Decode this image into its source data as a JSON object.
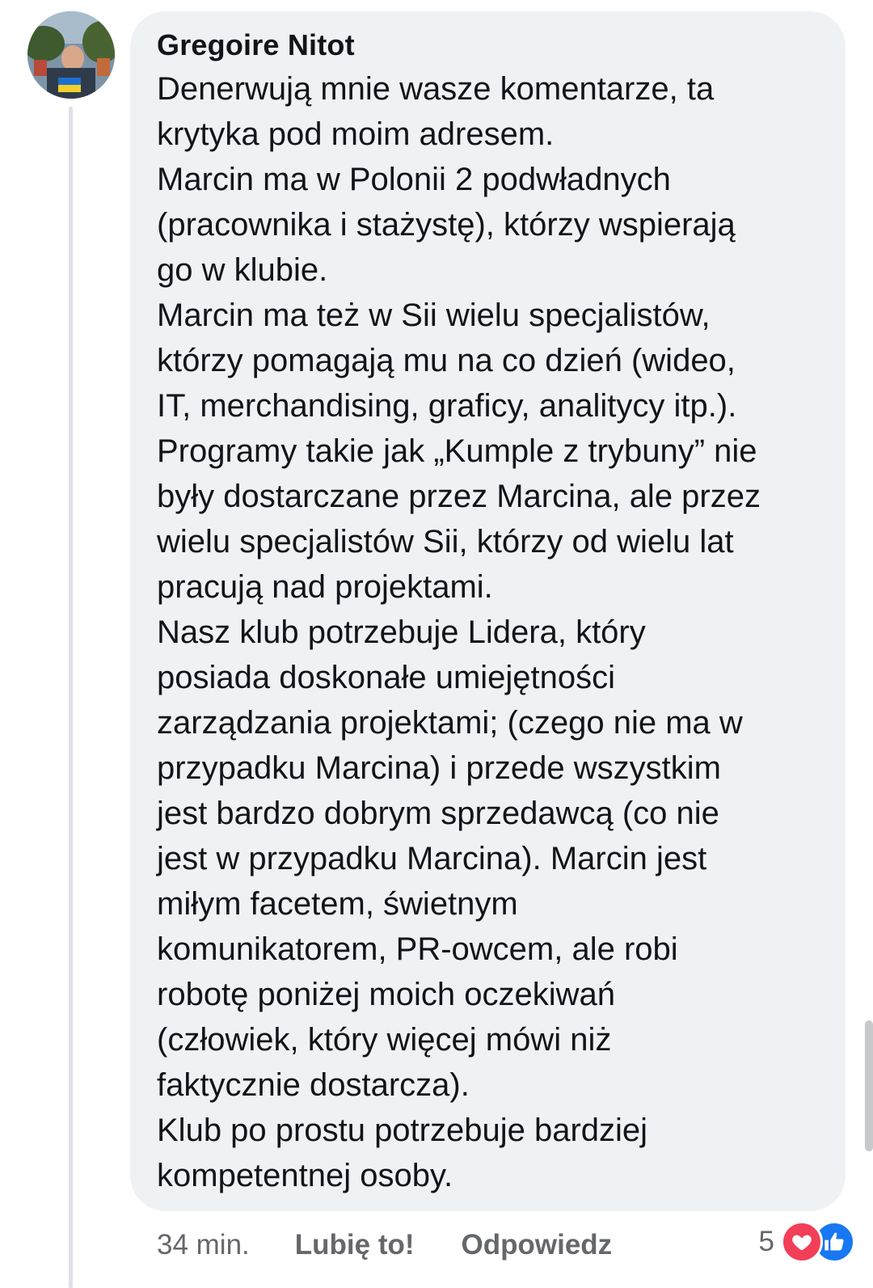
{
  "comment": {
    "author": "Gregoire Nitot",
    "text": "Denerwują mnie wasze komentarze, ta\nkrytyka pod moim adresem.\nMarcin ma w Polonii 2 podwładnych\n(pracownika i stażystę), którzy wspierają\ngo w klubie.\nMarcin ma też w Sii wielu specjalistów,\nktórzy pomagają mu na co dzień (wideo,\nIT, merchandising, graficy, analitycy itp.).\nProgramy takie jak „Kumple z trybuny” nie\nbyły dostarczane przez Marcina, ale przez\nwielu specjalistów Sii, którzy od wielu lat\npracują nad projektami.\nNasz klub potrzebuje Lidera, który\nposiada doskonałe umiejętności\nzarządzania projektami; (czego nie ma w\nprzypadku Marcina) i przede wszystkim\njest bardzo dobrym sprzedawcą (co nie\njest w przypadku Marcina). Marcin jest\nmiłym facetem, świetnym\nkomunikatorem, PR-owcem, ale robi\nrobotę poniżej moich oczekiwań\n(człowiek, który więcej mówi niż\nfaktycznie dostarcza).\nKlub po prostu potrzebuje bardziej\nkompetentnej osoby.",
    "time": "34 min.",
    "like_label": "Lubię to!",
    "reply_label": "Odpowiedz",
    "reaction_count": "5",
    "reaction_icons": [
      "love-icon",
      "like-icon"
    ]
  },
  "colors": {
    "bubble_bg": "#eff2f5",
    "text": "#111418",
    "meta_text": "#65676b",
    "love": "#f33e58",
    "like": "#1877f2"
  }
}
